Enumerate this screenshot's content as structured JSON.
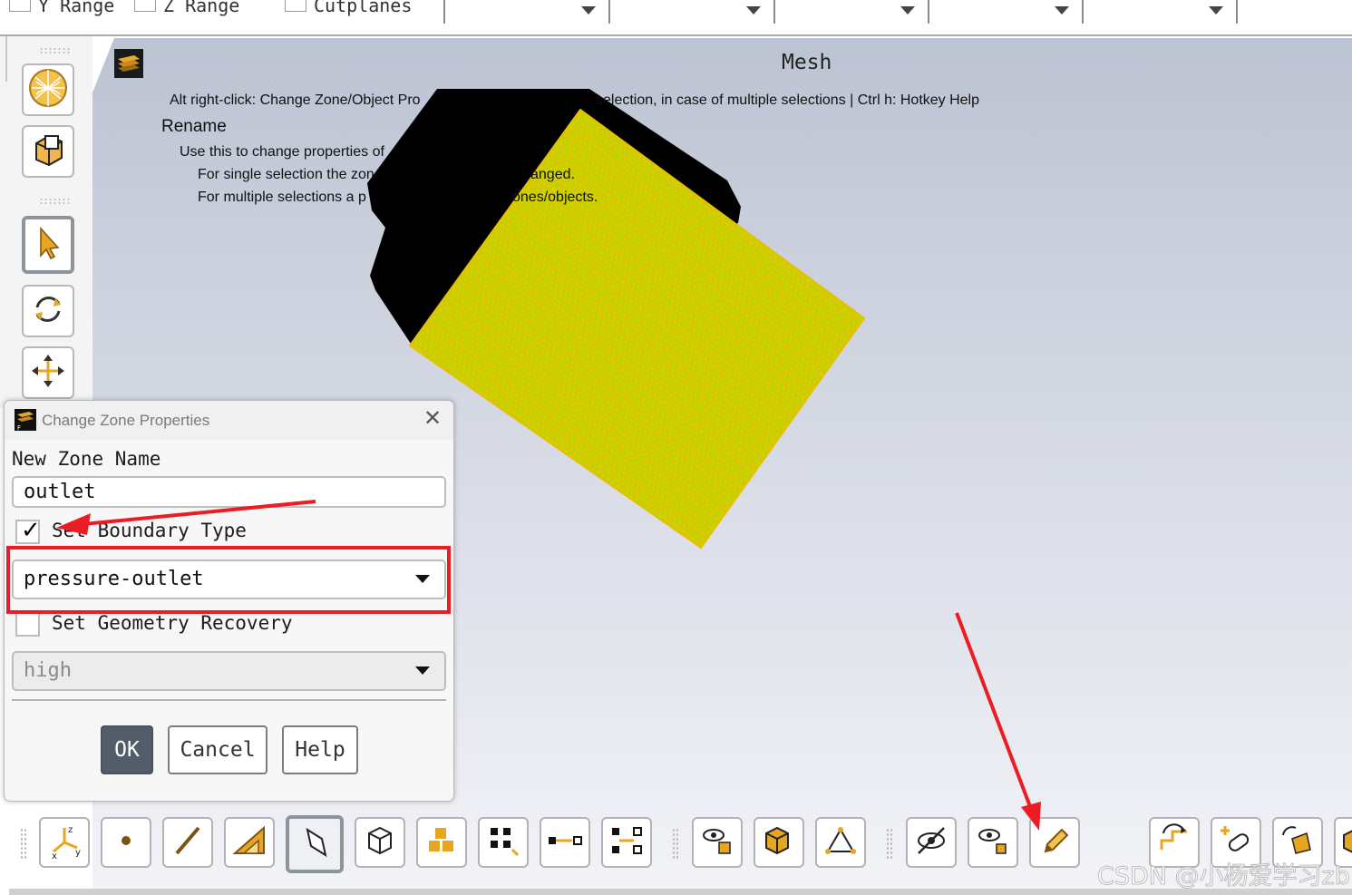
{
  "top_toolbar": {
    "checks": [
      {
        "label": "Y Range",
        "checked": false
      },
      {
        "label": "Z Range",
        "checked": false
      },
      {
        "label": "Cutplanes",
        "checked": false
      }
    ],
    "dropdowns": [
      "",
      "",
      "",
      "",
      ""
    ]
  },
  "viewport": {
    "title": "Mesh",
    "hint_line": "Alt right-click: Change Zone/Object Pro",
    "hint_line_tail": "selection, in case of multiple selections | Ctrl h: Hotkey Help",
    "tooltip": {
      "heading": "Rename",
      "line1": "Use this to change properties of",
      "line2_a": "For single selection the zon",
      "line2_b": "anged.",
      "line3_a": "For multiple selections a p",
      "line3_b": "ones/objects."
    },
    "mesh_colors": {
      "face": "#b8d400",
      "edge": "#f2c500",
      "dark": "#000000"
    }
  },
  "left_tools": [
    {
      "icon": "mesh-sphere-icon"
    },
    {
      "icon": "box-view-icon"
    },
    {
      "icon": "select-pointer-icon",
      "active": true
    },
    {
      "icon": "rotate-icon"
    },
    {
      "icon": "pan-icon"
    }
  ],
  "bottom_tools": [
    {
      "icon": "axis-triad-icon"
    },
    {
      "icon": "point-select-icon"
    },
    {
      "icon": "edge-select-icon"
    },
    {
      "icon": "face-select-icon"
    },
    {
      "icon": "zone-select-icon",
      "active": true
    },
    {
      "icon": "cell-select-icon"
    },
    {
      "icon": "multi-cell-icon"
    },
    {
      "icon": "node-select-icon"
    },
    {
      "icon": "path-select-icon"
    },
    {
      "icon": "connect-select-icon"
    },
    {
      "icon": "show-hide-icon"
    },
    {
      "icon": "object-view-icon"
    },
    {
      "icon": "vertex-view-icon"
    },
    {
      "icon": "hide-icon"
    },
    {
      "icon": "show-icon"
    },
    {
      "icon": "edit-pencil-icon"
    },
    {
      "icon": "swap-icon"
    },
    {
      "icon": "add-link-icon"
    },
    {
      "icon": "rotate-plane-icon"
    },
    {
      "icon": "cube-edge-icon"
    }
  ],
  "watermark": "CSDN @小杨爱学习zb",
  "dialog": {
    "title": "Change Zone Properties",
    "zone_name_label": "New Zone Name",
    "zone_name_value": "outlet",
    "boundary_check_label": "Set Boundary Type",
    "boundary_checked": true,
    "boundary_type": "pressure-outlet",
    "geometry_check_label": "Set Geometry Recovery",
    "geometry_checked": false,
    "geometry_value": "high",
    "ok": "OK",
    "cancel": "Cancel",
    "help": "Help"
  },
  "annotation_color": "#ec1c24"
}
